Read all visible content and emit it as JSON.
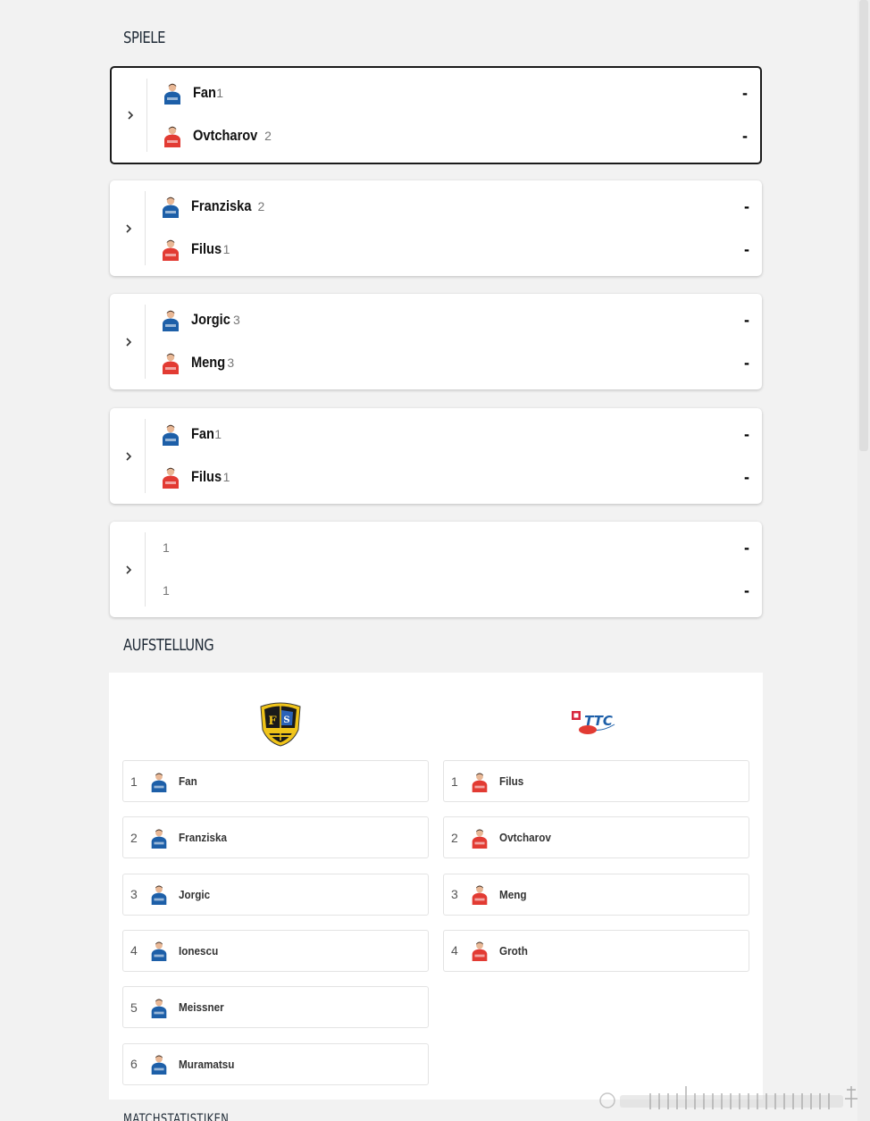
{
  "sections": {
    "games_title": "SPIELE",
    "lineup_title": "AUFSTELLUNG",
    "next_title": "MATCHSTATISTIKEN"
  },
  "colors": {
    "home_team": "#1d5fa8",
    "away_team": "#e23b33",
    "selected_border": "#1b1b1b"
  },
  "matches": [
    {
      "home": {
        "name": "Fan",
        "number": "1"
      },
      "away": {
        "name": "Ovtcharov",
        "number": "2"
      },
      "home_score": "-",
      "away_score": "-",
      "selected": true
    },
    {
      "home": {
        "name": "Franziska",
        "number": "2"
      },
      "away": {
        "name": "Filus",
        "number": "1"
      },
      "home_score": "-",
      "away_score": "-"
    },
    {
      "home": {
        "name": "Jorgic",
        "number": "3"
      },
      "away": {
        "name": "Meng",
        "number": "3"
      },
      "home_score": "-",
      "away_score": "-"
    },
    {
      "home": {
        "name": "Fan",
        "number": "1"
      },
      "away": {
        "name": "Filus",
        "number": "1"
      },
      "home_score": "-",
      "away_score": "-"
    },
    {
      "home": {
        "name": "",
        "number": "1"
      },
      "away": {
        "name": "",
        "number": "1"
      },
      "home_score": "-",
      "away_score": "-"
    }
  ],
  "lineup": {
    "home_logo": "saarbruecken-club-crest",
    "away_logo": "ttc-club-logo",
    "home": [
      {
        "number": "1",
        "name": "Fan"
      },
      {
        "number": "2",
        "name": "Franziska"
      },
      {
        "number": "3",
        "name": "Jorgic"
      },
      {
        "number": "4",
        "name": "Ionescu"
      },
      {
        "number": "5",
        "name": "Meissner"
      },
      {
        "number": "6",
        "name": "Muramatsu"
      }
    ],
    "away": [
      {
        "number": "1",
        "name": "Filus"
      },
      {
        "number": "2",
        "name": "Ovtcharov"
      },
      {
        "number": "3",
        "name": "Meng"
      },
      {
        "number": "4",
        "name": "Groth"
      }
    ]
  }
}
